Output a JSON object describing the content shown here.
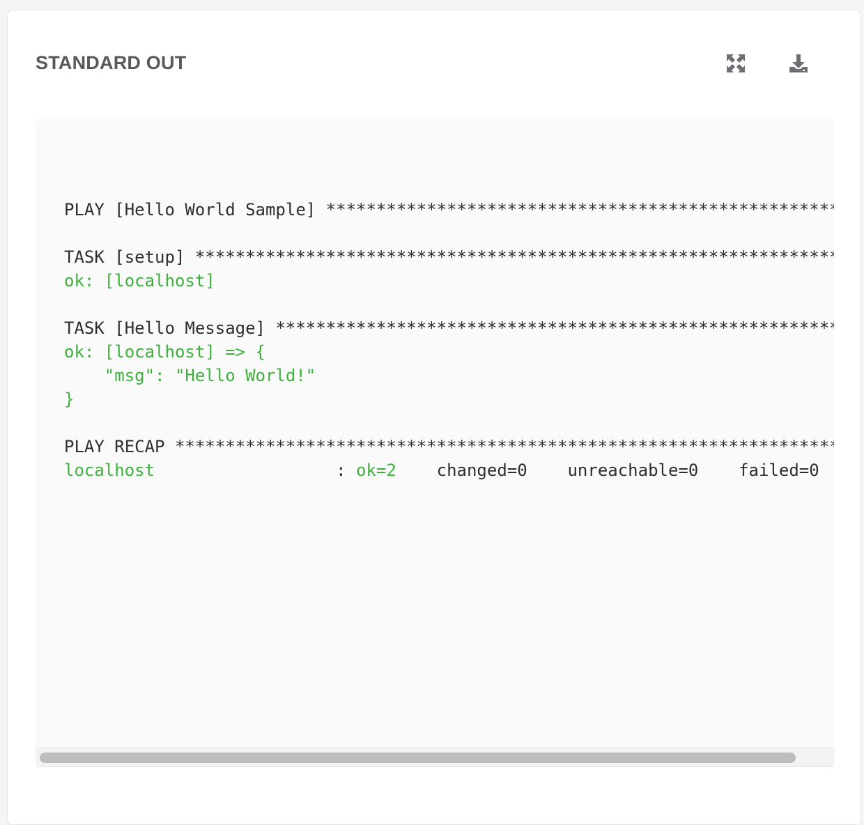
{
  "panel": {
    "title": "STANDARD OUT",
    "toolbar": {
      "expand_icon": "expand-arrows-icon",
      "download_icon": "download-icon"
    }
  },
  "stdout": {
    "lines": [
      {
        "text": "PLAY [Hello World Sample] ************************************************************",
        "kind": "plain"
      },
      {
        "text": "",
        "kind": "plain"
      },
      {
        "text": "TASK [setup] *************************************************************************",
        "kind": "plain"
      },
      {
        "text": "ok: [localhost]",
        "kind": "ok"
      },
      {
        "text": "",
        "kind": "plain"
      },
      {
        "text": "TASK [Hello Message] *****************************************************************",
        "kind": "plain"
      },
      {
        "text": "ok: [localhost] => {",
        "kind": "ok"
      },
      {
        "text": "    \"msg\": \"Hello World!\"",
        "kind": "ok"
      },
      {
        "text": "}",
        "kind": "ok"
      },
      {
        "text": "",
        "kind": "plain"
      },
      {
        "text": "PLAY RECAP ***************************************************************************",
        "kind": "plain"
      }
    ],
    "recap": {
      "host": "localhost",
      "sep": "                  : ",
      "ok": "ok=2",
      "changed": "    changed=0",
      "unreachable": "    unreachable=0",
      "failed": "    failed=0"
    }
  },
  "colors": {
    "ok_green": "#3cb13c",
    "text": "#2e2e2e",
    "title": "#58595b"
  }
}
